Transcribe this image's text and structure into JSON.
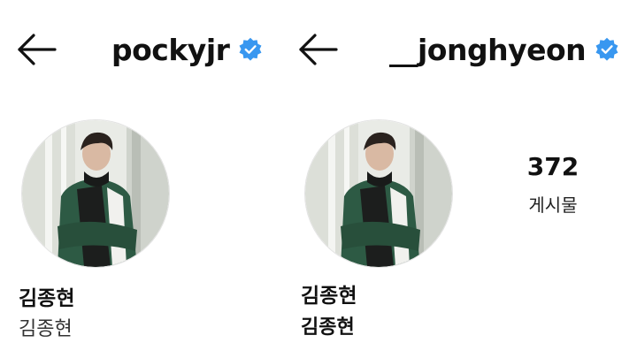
{
  "profiles": [
    {
      "username": "pockyjr",
      "display_name": "김종현",
      "bio": "김종현"
    },
    {
      "username": "__jonghyeon",
      "display_name": "김종현",
      "bio": "김종현",
      "posts_count": "372",
      "posts_label": "게시물"
    }
  ],
  "icons": {
    "back": "arrow-left-icon",
    "verified": "verified-badge-icon"
  },
  "colors": {
    "verified_blue": "#3897f0",
    "text": "#111111",
    "background": "#ffffff"
  }
}
